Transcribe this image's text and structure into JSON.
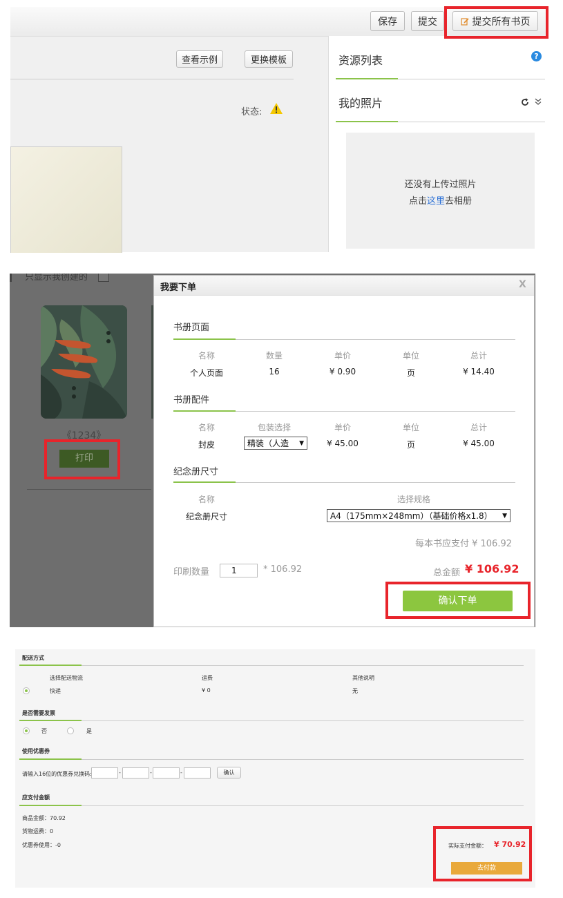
{
  "panel1": {
    "toolbar": {
      "save": "保存",
      "submit": "提交",
      "submit_all": "提交所有书页"
    },
    "editor": {
      "view_example": "查看示例",
      "change_template": "更换模板",
      "status_label": "状态:"
    },
    "sidebar": {
      "resource_list": "资源列表",
      "my_photos": "我的照片",
      "empty_line1": "还没有上传过照片",
      "empty_prefix": "点击",
      "empty_link": "这里",
      "empty_suffix": "去相册"
    }
  },
  "panel2": {
    "bg_text": "只显示我创建的",
    "book_title": "《1234》",
    "print_button": "打印",
    "dialog": {
      "title": "我要下单",
      "close": "X",
      "pages": {
        "heading": "书册页面",
        "headers": [
          "名称",
          "数量",
          "单价",
          "单位",
          "总计"
        ],
        "row": [
          "个人页面",
          "16",
          "¥ 0.90",
          "页",
          "¥ 14.40"
        ]
      },
      "accessories": {
        "heading": "书册配件",
        "headers": [
          "名称",
          "包装选择",
          "单价",
          "单位",
          "总计"
        ],
        "row_name": "封皮",
        "packaging_selected": "精装（人造",
        "row_price": "¥ 45.00",
        "row_unit": "页",
        "row_total": "¥ 45.00"
      },
      "size": {
        "heading": "纪念册尺寸",
        "headers": [
          "名称",
          "选择规格"
        ],
        "row_name": "纪念册尺寸",
        "spec_selected": "A4（175mm×248mm）（基础价格x1.8）"
      },
      "per_book": "每本书应支付 ¥ 106.92",
      "qty_label": "印刷数量",
      "qty_value": "1",
      "qty_mult": "* 106.92",
      "total_label": "总金额",
      "total_value": "¥ 106.92",
      "confirm": "确认下单"
    }
  },
  "panel3": {
    "delivery": {
      "heading": "配送方式",
      "headers": [
        "选择配送物流",
        "运费",
        "其他说明"
      ],
      "row": [
        "快递",
        "¥ 0",
        "无"
      ]
    },
    "invoice": {
      "heading": "是否需要发票",
      "no": "否",
      "yes": "是"
    },
    "coupon": {
      "heading": "使用优惠券",
      "prompt": "请输入16位的优惠券兑换码:",
      "confirm": "确认"
    },
    "payable": {
      "heading": "应支付金额",
      "goods": "商品金额：70.92",
      "shipping": "货物运费：0",
      "coupon_used": "优惠券使用：-0",
      "actual_label": "实际支付金额：",
      "actual_value": "¥ 70.92",
      "pay": "去付款"
    }
  },
  "colors": {
    "accent_green": "#8bc34a",
    "price_red": "#e8242b",
    "pay_orange": "#e9a93b",
    "highlight_red": "#e8242b"
  }
}
